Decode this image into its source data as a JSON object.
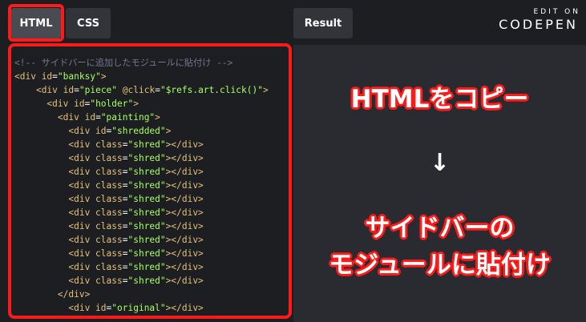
{
  "tabs": {
    "html_label": "HTML",
    "css_label": "CSS",
    "result_label": "Result"
  },
  "brand": {
    "edit_on": "EDIT ON",
    "name": "CODEPEN"
  },
  "code_lines": [
    [
      {
        "t": "comment",
        "v": "<!-- サイドバーに追加したモジュールに貼付け -->"
      }
    ],
    [
      {
        "t": "tag",
        "v": "<div "
      },
      {
        "t": "attr",
        "v": "id"
      },
      {
        "t": "pun",
        "v": "="
      },
      {
        "t": "str",
        "v": "\"banksy\""
      },
      {
        "t": "tag",
        "v": ">"
      }
    ],
    [
      {
        "t": "pun",
        "v": "    "
      },
      {
        "t": "tag",
        "v": "<div "
      },
      {
        "t": "attr",
        "v": "id"
      },
      {
        "t": "pun",
        "v": "="
      },
      {
        "t": "str",
        "v": "\"piece\""
      },
      {
        "t": "pun",
        "v": " "
      },
      {
        "t": "attr",
        "v": "@click"
      },
      {
        "t": "pun",
        "v": "="
      },
      {
        "t": "str",
        "v": "\"$refs.art.click()\""
      },
      {
        "t": "tag",
        "v": ">"
      }
    ],
    [
      {
        "t": "pun",
        "v": "      "
      },
      {
        "t": "tag",
        "v": "<div "
      },
      {
        "t": "attr",
        "v": "id"
      },
      {
        "t": "pun",
        "v": "="
      },
      {
        "t": "str",
        "v": "\"holder\""
      },
      {
        "t": "tag",
        "v": ">"
      }
    ],
    [
      {
        "t": "pun",
        "v": "        "
      },
      {
        "t": "tag",
        "v": "<div "
      },
      {
        "t": "attr",
        "v": "id"
      },
      {
        "t": "pun",
        "v": "="
      },
      {
        "t": "str",
        "v": "\"painting\""
      },
      {
        "t": "tag",
        "v": ">"
      }
    ],
    [
      {
        "t": "pun",
        "v": "          "
      },
      {
        "t": "tag",
        "v": "<div "
      },
      {
        "t": "attr",
        "v": "id"
      },
      {
        "t": "pun",
        "v": "="
      },
      {
        "t": "str",
        "v": "\"shredded\""
      },
      {
        "t": "tag",
        "v": ">"
      }
    ],
    [
      {
        "t": "pun",
        "v": "          "
      },
      {
        "t": "tag",
        "v": "<div "
      },
      {
        "t": "attr",
        "v": "class"
      },
      {
        "t": "pun",
        "v": "="
      },
      {
        "t": "str",
        "v": "\"shred\""
      },
      {
        "t": "tag",
        "v": "></div>"
      }
    ],
    [
      {
        "t": "pun",
        "v": "          "
      },
      {
        "t": "tag",
        "v": "<div "
      },
      {
        "t": "attr",
        "v": "class"
      },
      {
        "t": "pun",
        "v": "="
      },
      {
        "t": "str",
        "v": "\"shred\""
      },
      {
        "t": "tag",
        "v": "></div>"
      }
    ],
    [
      {
        "t": "pun",
        "v": "          "
      },
      {
        "t": "tag",
        "v": "<div "
      },
      {
        "t": "attr",
        "v": "class"
      },
      {
        "t": "pun",
        "v": "="
      },
      {
        "t": "str",
        "v": "\"shred\""
      },
      {
        "t": "tag",
        "v": "></div>"
      }
    ],
    [
      {
        "t": "pun",
        "v": "          "
      },
      {
        "t": "tag",
        "v": "<div "
      },
      {
        "t": "attr",
        "v": "class"
      },
      {
        "t": "pun",
        "v": "="
      },
      {
        "t": "str",
        "v": "\"shred\""
      },
      {
        "t": "tag",
        "v": "></div>"
      }
    ],
    [
      {
        "t": "pun",
        "v": "          "
      },
      {
        "t": "tag",
        "v": "<div "
      },
      {
        "t": "attr",
        "v": "class"
      },
      {
        "t": "pun",
        "v": "="
      },
      {
        "t": "str",
        "v": "\"shred\""
      },
      {
        "t": "tag",
        "v": "></div>"
      }
    ],
    [
      {
        "t": "pun",
        "v": "          "
      },
      {
        "t": "tag",
        "v": "<div "
      },
      {
        "t": "attr",
        "v": "class"
      },
      {
        "t": "pun",
        "v": "="
      },
      {
        "t": "str",
        "v": "\"shred\""
      },
      {
        "t": "tag",
        "v": "></div>"
      }
    ],
    [
      {
        "t": "pun",
        "v": "          "
      },
      {
        "t": "tag",
        "v": "<div "
      },
      {
        "t": "attr",
        "v": "class"
      },
      {
        "t": "pun",
        "v": "="
      },
      {
        "t": "str",
        "v": "\"shred\""
      },
      {
        "t": "tag",
        "v": "></div>"
      }
    ],
    [
      {
        "t": "pun",
        "v": "          "
      },
      {
        "t": "tag",
        "v": "<div "
      },
      {
        "t": "attr",
        "v": "class"
      },
      {
        "t": "pun",
        "v": "="
      },
      {
        "t": "str",
        "v": "\"shred\""
      },
      {
        "t": "tag",
        "v": "></div>"
      }
    ],
    [
      {
        "t": "pun",
        "v": "          "
      },
      {
        "t": "tag",
        "v": "<div "
      },
      {
        "t": "attr",
        "v": "class"
      },
      {
        "t": "pun",
        "v": "="
      },
      {
        "t": "str",
        "v": "\"shred\""
      },
      {
        "t": "tag",
        "v": "></div>"
      }
    ],
    [
      {
        "t": "pun",
        "v": "          "
      },
      {
        "t": "tag",
        "v": "<div "
      },
      {
        "t": "attr",
        "v": "class"
      },
      {
        "t": "pun",
        "v": "="
      },
      {
        "t": "str",
        "v": "\"shred\""
      },
      {
        "t": "tag",
        "v": "></div>"
      }
    ],
    [
      {
        "t": "pun",
        "v": "          "
      },
      {
        "t": "tag",
        "v": "<div "
      },
      {
        "t": "attr",
        "v": "class"
      },
      {
        "t": "pun",
        "v": "="
      },
      {
        "t": "str",
        "v": "\"shred\""
      },
      {
        "t": "tag",
        "v": "></div>"
      }
    ],
    [
      {
        "t": "pun",
        "v": "        "
      },
      {
        "t": "tag",
        "v": "</div>"
      }
    ],
    [
      {
        "t": "pun",
        "v": "          "
      },
      {
        "t": "tag",
        "v": "<div "
      },
      {
        "t": "attr",
        "v": "id"
      },
      {
        "t": "pun",
        "v": "="
      },
      {
        "t": "str",
        "v": "\"original\""
      },
      {
        "t": "tag",
        "v": "></div>"
      }
    ]
  ],
  "annotations": {
    "copy_html": "HTMLをコピー",
    "arrow": "↓",
    "paste_line1": "サイドバーの",
    "paste_line2": "モジュールに貼付け"
  },
  "colors": {
    "highlight": "#ff1a1a",
    "background": "#1d1e22",
    "tag": "#e5c07b",
    "string": "#a8ff60",
    "comment": "#717790"
  }
}
